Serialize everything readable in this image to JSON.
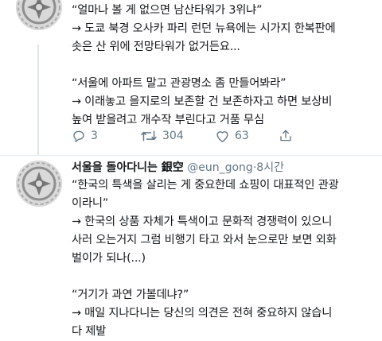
{
  "tweet1": {
    "lines": [
      "“얼마나 볼 게 없으면 남산타워가 3위냐”",
      "→ 도쿄 북경 오사카 파리 런던 뉴욕에는 시가지 한복판에",
      "솟은 산 위에 전망타워가 없거든요...",
      "",
      "“서울에 아파트 말고 관광명소 좀 만들어봐라”",
      "→ 이래놓고 을지로의 보존할 건 보존하자고 하면 보상비",
      "높여 받을려고 개수작 부린다고 거품 무심"
    ],
    "actions": {
      "reply_count": "3",
      "retweet_count": "304",
      "like_count": "63"
    }
  },
  "tweet2": {
    "display_name": "서울을 돌아다니는 銀空",
    "handle": "@eun_gong",
    "separator": "·",
    "time": "8시간",
    "lines": [
      "“한국의 특색을 살리는 게 중요한데 쇼핑이 대표적인 관광",
      "이라니”",
      "→ 한국의 상품 자체가 특색이고 문화적 경쟁력이 있으니",
      "사러 오는거지 그럼 비행기 타고 와서 눈으로만 보면 외화",
      "벌이가 되나(...)",
      "",
      "“거기가 과연 가볼데냐?”",
      "→ 매일 지나다니는 당신의 의견은 전혀 중요하지 않습니",
      "다 제발"
    ]
  },
  "icons": {
    "avatar": "ornament-emblem-icon",
    "reply": "reply-bubble-icon",
    "retweet": "retweet-icon",
    "like": "heart-icon",
    "share": "share-icon"
  },
  "colors": {
    "text": "#14171a",
    "muted": "#657786",
    "divider": "#e6ecf0"
  }
}
